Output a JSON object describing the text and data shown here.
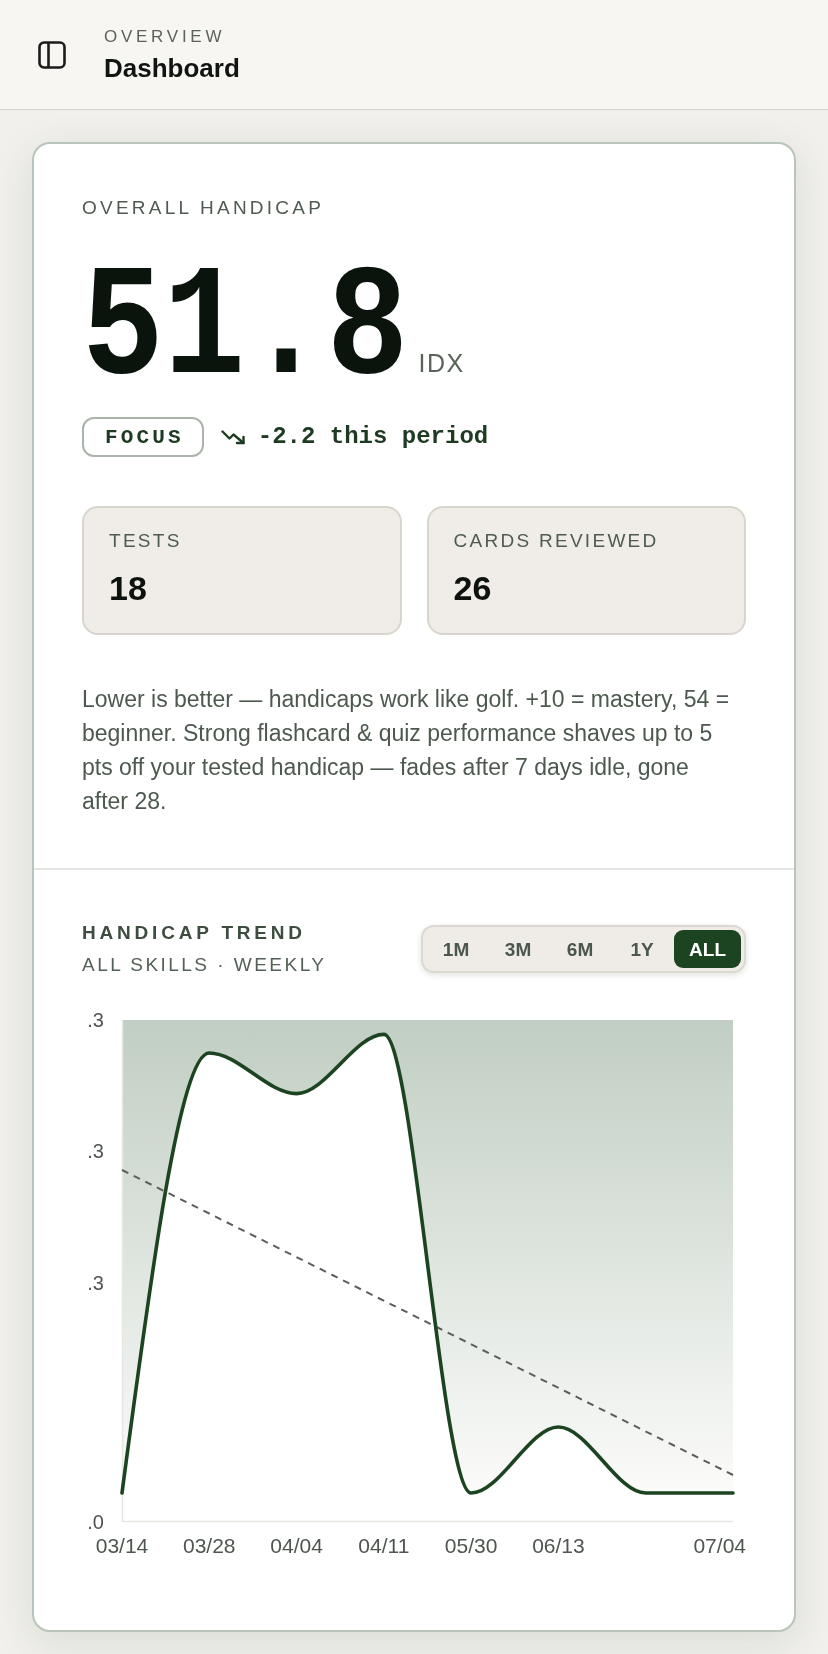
{
  "header": {
    "eyebrow": "OVERVIEW",
    "title": "Dashboard"
  },
  "handicap": {
    "label": "OVERALL HANDICAP",
    "value": "51.8",
    "unit": "IDX",
    "badge": "FOCUS",
    "change": "-2.2 this period"
  },
  "stats": [
    {
      "label": "TESTS",
      "value": "18"
    },
    {
      "label": "CARDS REVIEWED",
      "value": "26"
    }
  ],
  "note": "Lower is better — handicaps work like golf. +10 = mastery, 54 = beginner. Strong flashcard & quiz performance shaves up to 5 pts off your tested handicap — fades after 7 days idle, gone after 28.",
  "trend": {
    "title": "HANDICAP TREND",
    "subtitle": "ALL SKILLS · WEEKLY",
    "ranges": [
      {
        "label": "1M",
        "selected": false
      },
      {
        "label": "3M",
        "selected": false
      },
      {
        "label": "6M",
        "selected": false
      },
      {
        "label": "1Y",
        "selected": false
      },
      {
        "label": "ALL",
        "selected": true
      }
    ],
    "y_labels": [
      ".3",
      ".3",
      ".3",
      ".0"
    ],
    "x_labels": [
      "03/14",
      "03/28",
      "04/04",
      "04/11",
      "05/30",
      "06/13",
      "07/04"
    ]
  }
}
